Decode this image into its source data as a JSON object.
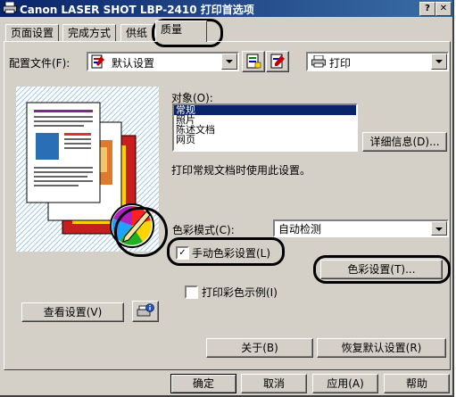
{
  "window": {
    "title": "Canon LASER SHOT LBP-2410 打印首选项",
    "help_btn": "?",
    "close_btn": "✕"
  },
  "tabs": [
    {
      "label": "页面设置"
    },
    {
      "label": "完成方式"
    },
    {
      "label": "供纸"
    },
    {
      "label": "质量"
    }
  ],
  "profile": {
    "label": "配置文件(F):",
    "value": "默认设置",
    "print_target": "打印"
  },
  "target": {
    "label": "对象(O):",
    "items": [
      "常规",
      "照片",
      "陈述文档",
      "网页"
    ],
    "selected": "常规",
    "details_button": "详细信息(D)...",
    "description": "打印常规文档时使用此设置。"
  },
  "color": {
    "mode_label": "色彩模式(C):",
    "mode_value": "自动检测",
    "manual_label": "手动色彩设置(L)",
    "manual_checked": true,
    "settings_button": "色彩设置(T)...",
    "sample_label": "打印彩色示例(I)",
    "sample_checked": false
  },
  "view_settings_button": "查看设置(V)",
  "about_button": "关于(B)",
  "restore_button": "恢复默认设置(R)",
  "footer": {
    "ok": "确定",
    "cancel": "取消",
    "apply": "应用(A)",
    "help": "帮助"
  },
  "accent_colors": {
    "titlebar": "#0a246a",
    "selection": "#0a246a",
    "face": "#d4d0c8"
  }
}
